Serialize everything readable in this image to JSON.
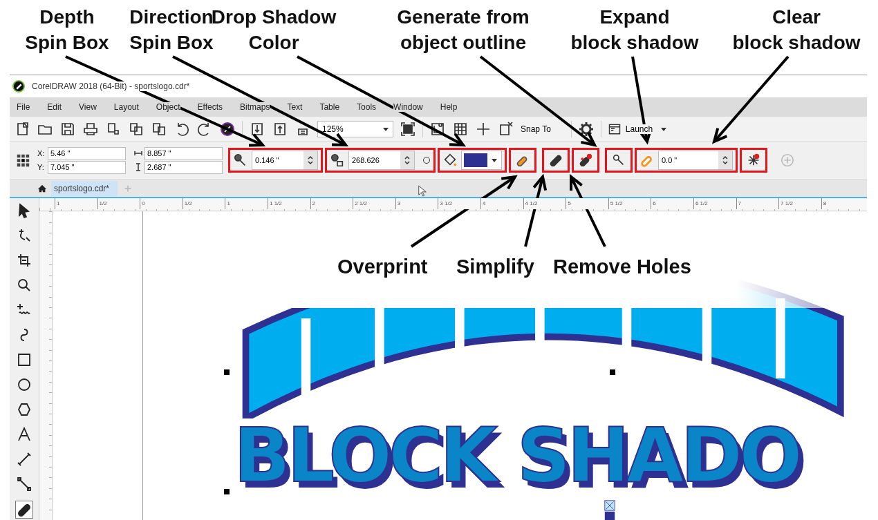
{
  "callouts_top": [
    "Depth\nSpin Box",
    "Direction\nSpin Box",
    "Drop Shadow\nColor",
    "Generate from\nobject outline",
    "Expand\nblock shadow",
    "Clear\nblock shadow"
  ],
  "callouts_bottom": [
    "Overprint",
    "Simplify",
    "Remove Holes"
  ],
  "window": {
    "title": "CorelDRAW 2018 (64-Bit) - sportslogo.cdr*"
  },
  "menu": [
    "File",
    "Edit",
    "View",
    "Layout",
    "Object",
    "Effects",
    "Bitmaps",
    "Text",
    "Table",
    "Tools",
    "Window",
    "Help"
  ],
  "toolbar": {
    "zoom": "125%",
    "snap": "Snap To",
    "launch": "Launch"
  },
  "property_bar": {
    "x_label": "X:",
    "x": "5.46 \"",
    "y_label": "Y:",
    "y": "7.045 \"",
    "width": "8.857 \"",
    "height": "2.687 \"",
    "depth": "0.146 \"",
    "direction": "268.626",
    "expand": "0.0 \""
  },
  "document_tabs": [
    {
      "label": "sportslogo.cdr*",
      "selected": true
    }
  ],
  "ruler_labels": [
    "1",
    "1/2",
    "0",
    "1/2",
    "1",
    "1 1/2",
    "2",
    "2 1/2",
    "3",
    "3 1/2",
    "4",
    "4 1/2",
    "5",
    "5 1/2",
    "6",
    "6 1/2",
    "7",
    "7 1/2",
    "8"
  ],
  "tools": [
    {
      "kind": "pick",
      "selected": false
    },
    {
      "kind": "freehand-pick",
      "selected": false
    },
    {
      "kind": "crop",
      "selected": false
    },
    {
      "kind": "zoom",
      "selected": false
    },
    {
      "kind": "freehand",
      "selected": false
    },
    {
      "kind": "artistic",
      "selected": false
    },
    {
      "kind": "rectangle",
      "selected": false
    },
    {
      "kind": "ellipse",
      "selected": false
    },
    {
      "kind": "polygon",
      "selected": false
    },
    {
      "kind": "text",
      "selected": false
    },
    {
      "kind": "dimension",
      "selected": false
    },
    {
      "kind": "connector",
      "selected": false
    },
    {
      "kind": "shadow",
      "selected": true
    }
  ],
  "artwork": {
    "text": "BLOCK SHADO"
  }
}
